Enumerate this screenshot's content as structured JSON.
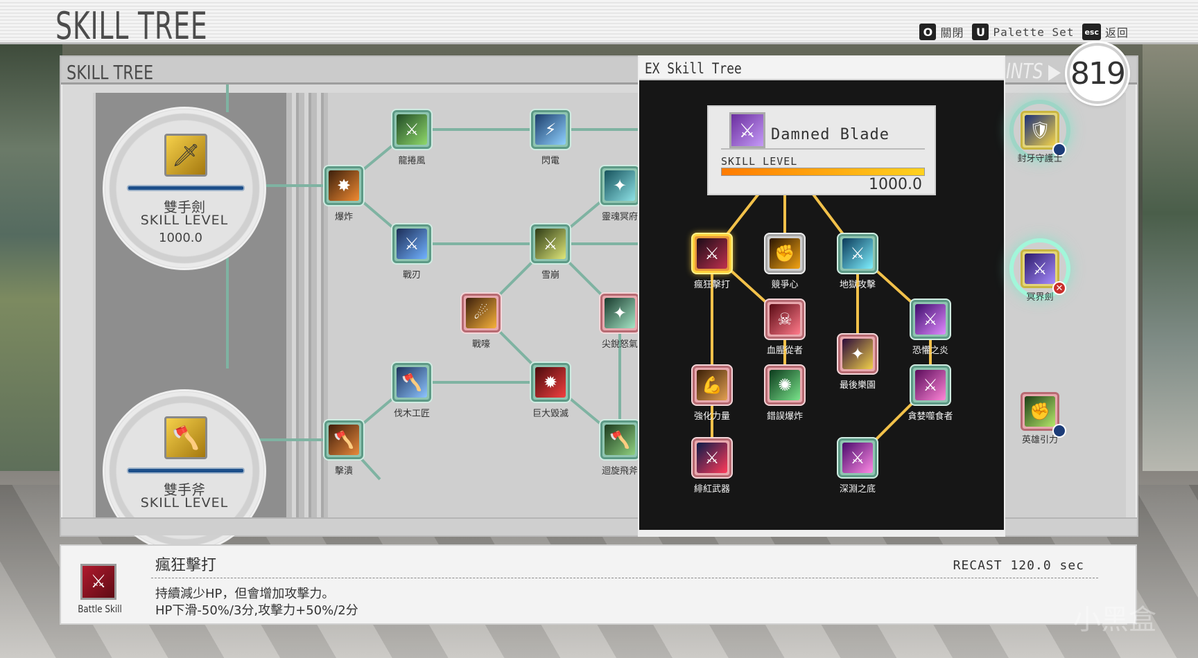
{
  "app_title": "SKILL TREE",
  "hotkeys": [
    {
      "key": "O",
      "label": "關閉"
    },
    {
      "key": "U",
      "label": "Palette Set"
    },
    {
      "key": "esc",
      "label": "返回"
    }
  ],
  "panel": {
    "title": "SKILL TREE",
    "points_label": "POINTS",
    "points_value": "819"
  },
  "weapons": [
    {
      "name": "雙手劍",
      "level_label": "SKILL LEVEL",
      "level": "1000.0"
    },
    {
      "name": "雙手斧",
      "level_label": "SKILL LEVEL",
      "level": ""
    }
  ],
  "tree_nodes": [
    {
      "label": "龍捲風"
    },
    {
      "label": "閃電"
    },
    {
      "label": "爆炸"
    },
    {
      "label": "靈魂冥府"
    },
    {
      "label": "戰刃"
    },
    {
      "label": "雪崩"
    },
    {
      "label": "戰嚎"
    },
    {
      "label": "尖銳怒氣"
    },
    {
      "label": "伐木工匠"
    },
    {
      "label": "巨大毀滅"
    },
    {
      "label": "擊潰"
    },
    {
      "label": "迴旋飛斧"
    }
  ],
  "ex_panel": {
    "title": "EX Skill Tree",
    "nodes": [
      {
        "label": "瘋狂擊打"
      },
      {
        "label": "競爭心"
      },
      {
        "label": "地獄攻擊"
      },
      {
        "label": "血腥從者"
      },
      {
        "label": "恐懼之炎"
      },
      {
        "label": "強化力量"
      },
      {
        "label": "最後樂園"
      },
      {
        "label": "錯誤爆炸"
      },
      {
        "label": "貪婪噬食者"
      },
      {
        "label": "緋紅武器"
      },
      {
        "label": "深淵之底"
      }
    ]
  },
  "tooltip": {
    "name": "Damned Blade",
    "level_label": "SKILL LEVEL",
    "level": "1000.0",
    "level_fill": 1.0
  },
  "right_nodes": [
    {
      "label": "封牙守護士"
    },
    {
      "label": "冥界劍"
    },
    {
      "label": "英雄引力"
    }
  ],
  "info": {
    "type": "Battle Skill",
    "name": "瘋狂擊打",
    "recast": "RECAST 120.0 sec",
    "desc1": "持續減少HP，但會增加攻擊力。",
    "desc2": "HP下滑-50%/3分,攻擊力+50%/2分"
  },
  "watermark": "小黑盒",
  "colors": {
    "node_teal": "#8fc5b1",
    "node_pink": "#e8a8ae",
    "ex_background": "#161616",
    "connector_gold": "#f2c14a",
    "level_bar_blue": "#1d4f8a"
  }
}
